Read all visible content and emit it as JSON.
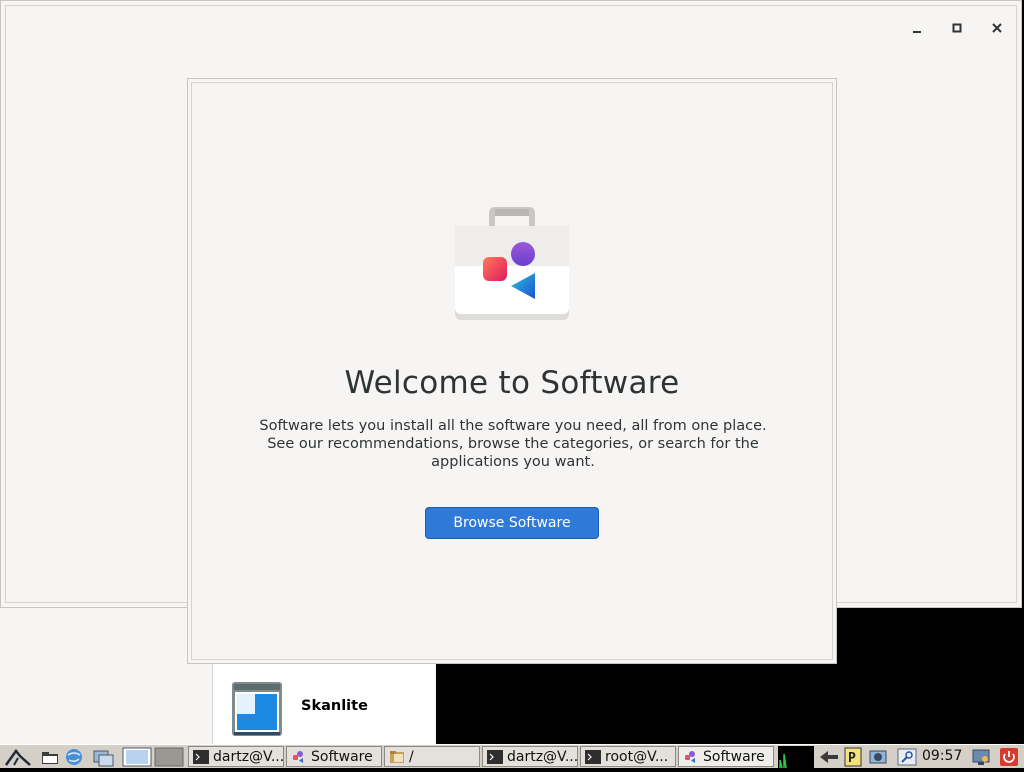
{
  "window": {
    "controls": {
      "minimize_icon": "minimize-icon",
      "maximize_icon": "maximize-icon",
      "close_icon": "close-icon"
    }
  },
  "welcome": {
    "title": "Welcome to Software",
    "description_lines": [
      "Software lets you install all the software you need, all from one place.",
      "See our recommendations, browse the categories, or search for the",
      "applications you want."
    ],
    "button_label": "Browse Software"
  },
  "background_app": {
    "name": "Skanlite"
  },
  "taskbar": {
    "tasks": [
      {
        "label": "dartz@V...",
        "icon": "terminal-icon"
      },
      {
        "label": "Software",
        "icon": "software-icon"
      },
      {
        "label": "/",
        "icon": "folder-icon"
      },
      {
        "label": "dartz@V...",
        "icon": "terminal-icon"
      },
      {
        "label": "root@V...",
        "icon": "terminal-icon"
      },
      {
        "label": "Software",
        "icon": "software-icon"
      }
    ],
    "clock": "09:57"
  },
  "colors": {
    "accent": "#2f7ad8",
    "window_bg": "#f6f5f4",
    "text": "#2e3436"
  }
}
